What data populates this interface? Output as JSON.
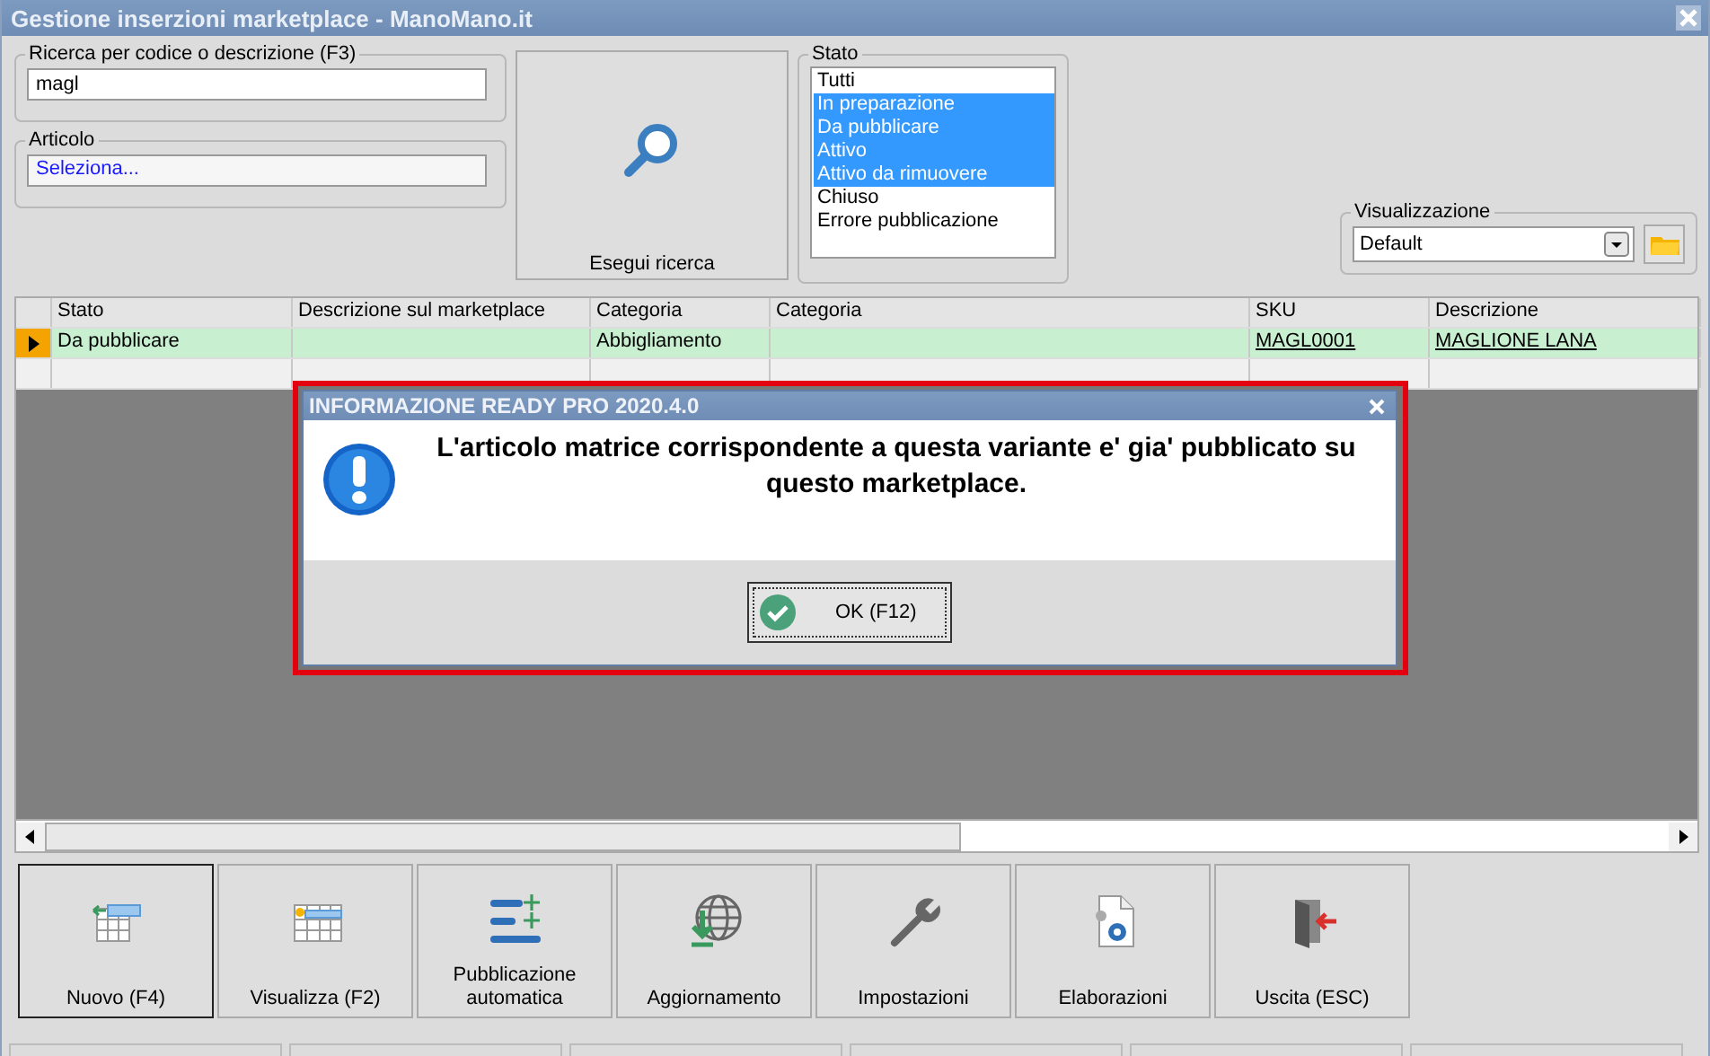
{
  "window": {
    "title": "Gestione inserzioni marketplace - ManoMano.it"
  },
  "search": {
    "label": "Ricerca per codice o descrizione (F3)",
    "value": "magl"
  },
  "article": {
    "label": "Articolo",
    "value": "Seleziona..."
  },
  "search_button": {
    "label": "Esegui ricerca"
  },
  "status_filter": {
    "label": "Stato",
    "items": [
      {
        "label": "Tutti",
        "selected": false
      },
      {
        "label": "In preparazione",
        "selected": true
      },
      {
        "label": "Da pubblicare",
        "selected": true
      },
      {
        "label": "Attivo",
        "selected": true
      },
      {
        "label": "Attivo da rimuovere",
        "selected": true
      },
      {
        "label": "Chiuso",
        "selected": false
      },
      {
        "label": "Errore pubblicazione",
        "selected": false
      }
    ]
  },
  "view": {
    "label": "Visualizzazione",
    "value": "Default"
  },
  "table": {
    "columns": [
      "Stato",
      "Descrizione sul marketplace",
      "Categoria",
      "Categoria",
      "SKU",
      "Descrizione"
    ],
    "rows": [
      {
        "current": true,
        "cells": [
          "Da pubblicare",
          "",
          "Abbigliamento",
          "",
          "MAGL0001",
          "MAGLIONE LANA"
        ]
      }
    ]
  },
  "dialog": {
    "title": "INFORMAZIONE READY PRO 2020.4.0",
    "message": "L'articolo matrice corrispondente a questa variante e' gia' pubblicato su questo marketplace.",
    "button": "OK (F12)"
  },
  "toolbar": [
    {
      "kind": "new",
      "label": "Nuovo (F4)",
      "selected": true
    },
    {
      "kind": "view",
      "label": "Visualizza (F2)",
      "selected": false
    },
    {
      "kind": "publish",
      "label": "Pubblicazione automatica",
      "selected": false
    },
    {
      "kind": "update",
      "label": "Aggiornamento",
      "selected": false
    },
    {
      "kind": "settings",
      "label": "Impostazioni",
      "selected": false
    },
    {
      "kind": "process",
      "label": "Elaborazioni",
      "selected": false
    },
    {
      "kind": "exit",
      "label": "Uscita (ESC)",
      "selected": false
    }
  ]
}
